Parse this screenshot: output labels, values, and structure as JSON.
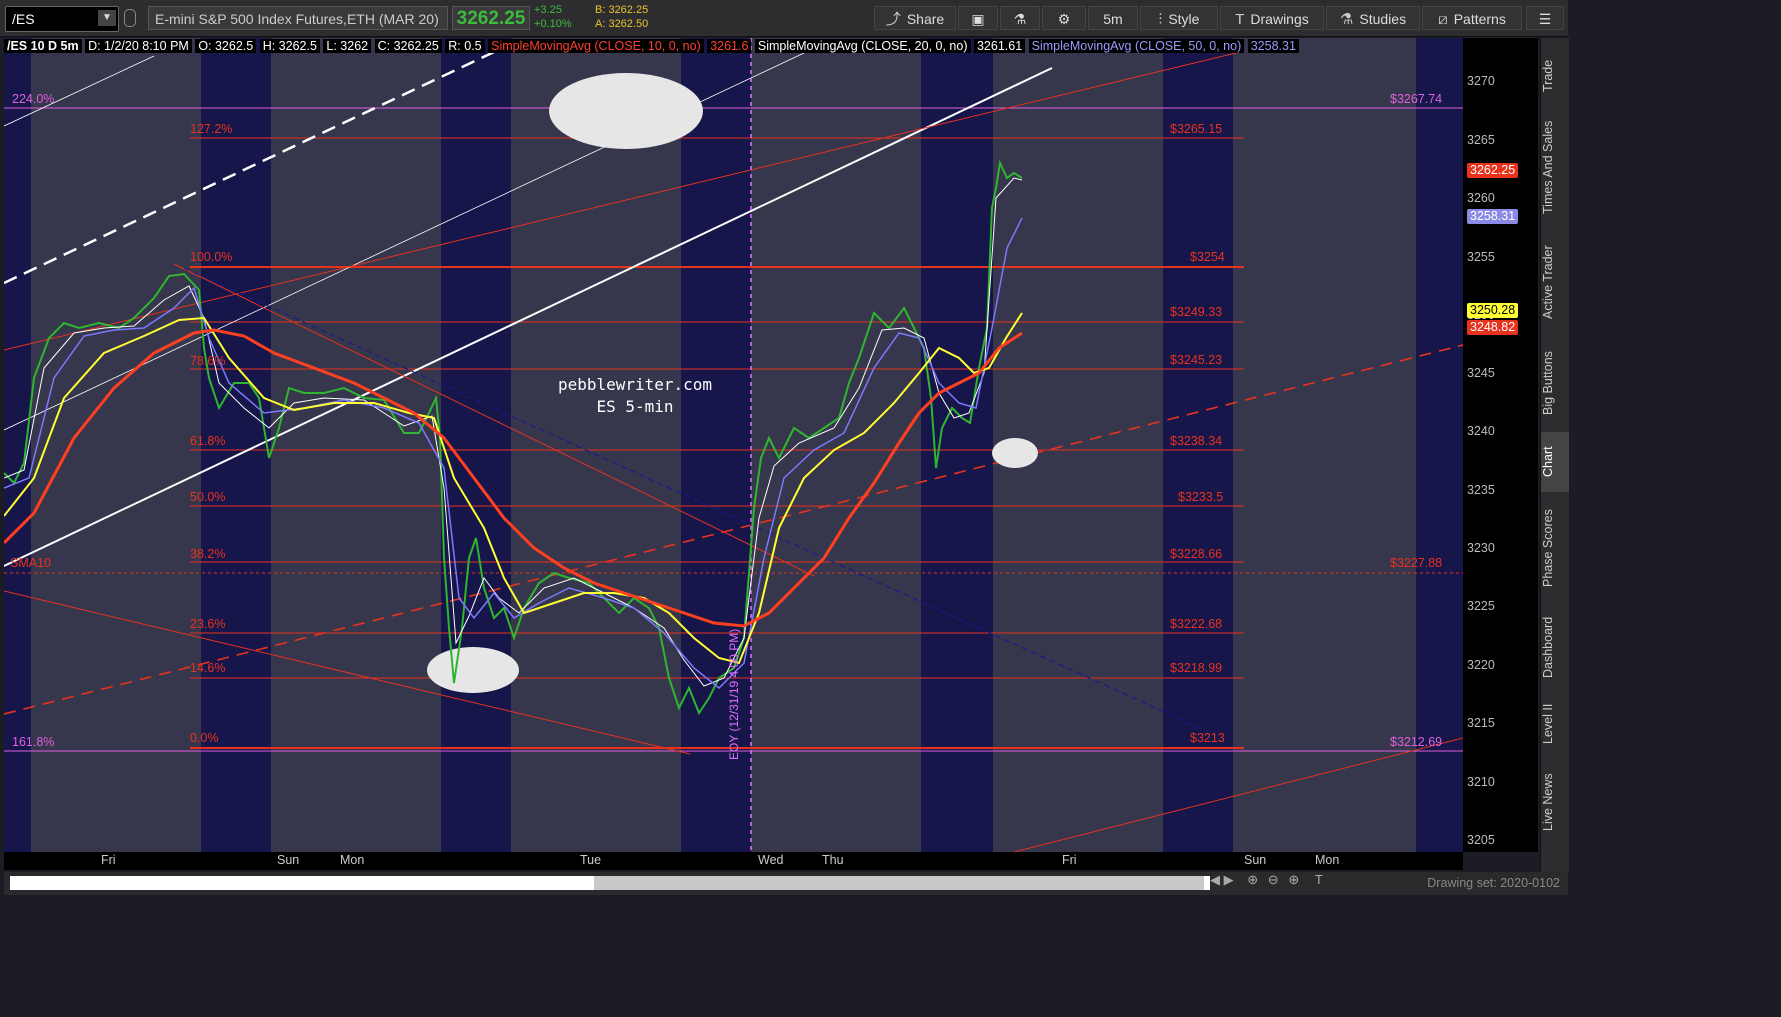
{
  "toolbar": {
    "symbol": "/ES",
    "instrument": "E-mini S&P 500 Index Futures,ETH (MAR 20)",
    "last_price": "3262.25",
    "change": "+3.25",
    "change_pct": "+0.10%",
    "bid": "B: 3262.25",
    "ask": "A: 3262.50",
    "share": "Share",
    "timeframe": "5m",
    "style": "Style",
    "drawings": "Drawings",
    "studies": "Studies",
    "patterns": "Patterns",
    "colors": {
      "up": "#3dbb3d",
      "bidask": "#e8c32a"
    }
  },
  "header": {
    "title": "/ES 10 D 5m",
    "date": "D: 1/2/20 8:10 PM",
    "open": "O: 3262.5",
    "high": "H: 3262.5",
    "low": "L: 3262",
    "close": "C: 3262.25",
    "range": "R: 0.5",
    "sma10": "SimpleMovingAvg (CLOSE, 10, 0, no)",
    "sma10_val": "3261.6",
    "sma20": "SimpleMovingAvg (CLOSE, 20, 0, no)",
    "sma20_val": "3261.61",
    "sma50": "SimpleMovingAvg (CLOSE, 50, 0, no)",
    "sma50_val": "3258.31"
  },
  "price_axis": {
    "ticks": [
      "3270",
      "3265",
      "3260",
      "3255",
      "3250",
      "3245",
      "3240",
      "3235",
      "3230",
      "3225",
      "3220",
      "3215",
      "3210",
      "3205"
    ],
    "flags": [
      {
        "value": "3262.25",
        "bg": "#e8321e",
        "fg": "#fff"
      },
      {
        "value": "3258.31",
        "bg": "#8a8ae6",
        "fg": "#fff"
      },
      {
        "value": "3250.28",
        "bg": "#ffff33",
        "fg": "#000"
      },
      {
        "value": "3248.82",
        "bg": "#e8321e",
        "fg": "#fff"
      }
    ]
  },
  "time_axis": {
    "labels": [
      "Fri",
      "Sun",
      "Mon",
      "Tue",
      "Wed",
      "Thu",
      "Fri",
      "Sun",
      "Mon"
    ]
  },
  "fib_levels": [
    {
      "pct": "127.2%",
      "price": "$3265.15"
    },
    {
      "pct": "100.0%",
      "price": "$3254"
    },
    {
      "pct": "",
      "price": "$3249.33"
    },
    {
      "pct": "78.6%",
      "price": "$3245.23"
    },
    {
      "pct": "61.8%",
      "price": "$3238.34"
    },
    {
      "pct": "50.0%",
      "price": "$3233.5"
    },
    {
      "pct": "38.2%",
      "price": "$3228.66"
    },
    {
      "pct": "23.6%",
      "price": "$3222.68"
    },
    {
      "pct": "14.6%",
      "price": "$3218.99"
    },
    {
      "pct": "0.0%",
      "price": "$3213"
    }
  ],
  "purple_levels": [
    {
      "pct": "224.0%",
      "price": "$3267.74"
    },
    {
      "pct": "161.8%",
      "price": "$3212.69"
    }
  ],
  "sma10_marker": {
    "label": "SMA10",
    "price": "$3227.88"
  },
  "watermark": {
    "line1": "pebblewriter.com",
    "line2": "ES 5-min"
  },
  "eoy_label": "EOY (12/31/19 4:00 PM)",
  "sidebar_tabs": [
    "Trade",
    "Times And Sales",
    "Active Trader",
    "Big Buttons",
    "Chart",
    "Phase Scores",
    "Dashboard",
    "Level II",
    "Live News"
  ],
  "drawing_set": "Drawing set: 2020-0102"
}
